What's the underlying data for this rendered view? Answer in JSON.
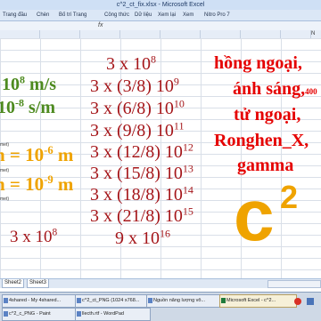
{
  "window": {
    "title": "c^2_ct_fix.xlsx - Microsoft Excel"
  },
  "ribbon": {
    "tabs": [
      "Trang đầu",
      "Chèn",
      "Bố trí Trang",
      "Công thức",
      "Dữ liệu",
      "Xem lại",
      "Xem",
      "Nitro Pro 7"
    ]
  },
  "columns": {
    "visible_edge_label": "N"
  },
  "sheets": [
    "Sheet2",
    "Sheet3"
  ],
  "taskbar": {
    "row1": [
      "4shared - My 4shared...",
      "c^2_ct_PNG (1024 x768...",
      "Nguồn năng lượng vô...",
      "Microsoft Excel - c^2..."
    ],
    "row2": [
      "c^2_c_PNG - Paint",
      "llecth.rtf - WordPad"
    ]
  },
  "overlay": {
    "left_units_1": "10",
    "left_units_1_exp": "8",
    "left_units_1_unit": " m/s",
    "left_units_2": "10",
    "left_units_2_exp": "-8",
    "left_units_2_unit": " s/m",
    "meter_label_1": "met)",
    "meter_label_2": "met)",
    "meter_label_3": "met)",
    "nano_1_prefix": "n = 10",
    "nano_1_exp": "-6",
    "nano_1_unit": " m",
    "nano_2_prefix": "n = 10",
    "nano_2_exp": "-9",
    "nano_2_unit": " m",
    "left_bottom_base": "3 x 10",
    "left_bottom_exp": "8",
    "center_values": [
      {
        "base": "3 x 10",
        "exp": "8"
      },
      {
        "base": "3 x (3/8) 10",
        "exp": "9"
      },
      {
        "base": "3 x (6/8) 10",
        "exp": "10"
      },
      {
        "base": "3 x (9/8) 10",
        "exp": "11"
      },
      {
        "base": "3 x (12/8) 10",
        "exp": "12"
      },
      {
        "base": "3 x (15/8) 10",
        "exp": "13"
      },
      {
        "base": "3 x (18/8) 10",
        "exp": "14"
      },
      {
        "base": "3 x (21/8) 10",
        "exp": "15"
      },
      {
        "base": "9 x 10",
        "exp": "16"
      }
    ],
    "right_lines": [
      "hồng ngoại,",
      "ánh sáng,",
      "tử ngoại,",
      "Ronghen_X,",
      "gamma"
    ],
    "right_line2_suffix": "400",
    "big_symbol": "c",
    "big_symbol_exp": "2"
  }
}
